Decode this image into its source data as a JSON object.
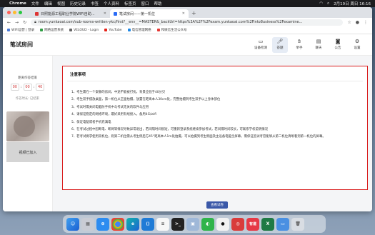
{
  "menubar": {
    "app": "Chrome",
    "items": [
      "文件",
      "编辑",
      "视图",
      "历史记录",
      "书签",
      "个人资料",
      "标签页",
      "窗口",
      "帮助"
    ],
    "datetime": "2月19日 周日 16:16"
  },
  "browser": {
    "tabs": [
      {
        "label": "日照能源工程职业学院WIFI自助...",
        "icon": "shield-icon"
      },
      {
        "label": "笔试房间——第一机位",
        "icon": "page-icon"
      }
    ],
    "url": "room.yunkaoai.com/sub-rooms-written-ykc/first?__env__=MASTER&_backUrl=https%3A%2F%2Fexam.yunkaoai.com%2Finto8usiness%2Fexamine...",
    "bookmarks": [
      "WIFI运营 | 登录",
      "网络运营系统",
      "VELOUD - Login",
      "YouTube",
      "电信管理网络",
      "和微信生活公众号"
    ]
  },
  "header": {
    "title": "笔试房间",
    "buttons": [
      {
        "label": "设备检测",
        "icon": "monitor-icon"
      },
      {
        "label": "答题",
        "icon": "mic-icon"
      },
      {
        "label": "举手",
        "icon": "hand-icon"
      },
      {
        "label": "聊天",
        "icon": "chat-icon"
      },
      {
        "label": "公告",
        "icon": "camera-icon"
      },
      {
        "label": "设置",
        "icon": "gear-icon"
      }
    ]
  },
  "left": {
    "timer_label": "距离作答结束",
    "hours": "00",
    "minutes": "00",
    "seconds": "40",
    "work_time": "作答时长: 已结束",
    "joined": "视频已加入"
  },
  "notice": {
    "title": "注意事项",
    "items": [
      "1、考生需在一个安静的房间，中途不能被打扰，背景应低于40分贝",
      "2、考生双手摆放桌面，第一机位从正面拍摄，放置在距离本人30cm处，完整拍摄到考生双手以上身体部位",
      "3、考试时需关闭电脑防手机中与考试无关的软件与应用",
      "4、请保证稳定的网络环境，最好采用有线接入，备用4G/wifi",
      "5、保证电脑或者手机充满电",
      "6、在考试过程中因断电、断网等情况导致异常退出，若间隔时间很短，可重新登录系统继续参加考试，若间隔时间较长，可联系学校说明情况",
      "7、若考试要求使用双机位，则第二机位需从考生侧后方45°距离本人1m处拍摄，可以拍摄到考生侧面及主设备电脑全屏幕，需保证监试考官能够从第二机位清晰看到第一机位的屏幕。"
    ],
    "enter_button": "查看试卷"
  },
  "dock": [
    "Finder",
    "Launchpad",
    "Safari",
    "Chrome",
    "Edge",
    "VS Code",
    "Notes",
    "Terminal",
    "Preview",
    "WeChat",
    "QQ",
    "NetEase",
    "有道",
    "Excel",
    "Files",
    "Trash"
  ]
}
